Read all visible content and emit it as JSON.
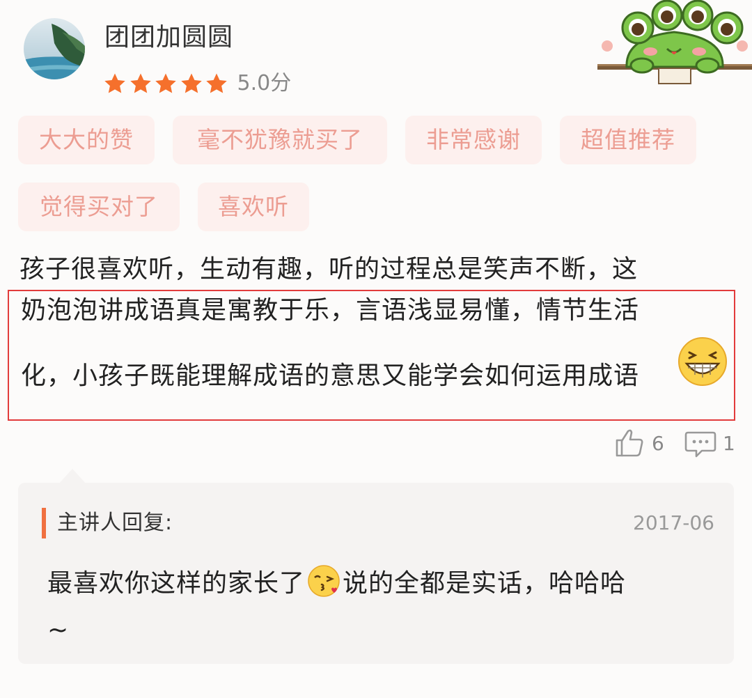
{
  "user": {
    "name": "团团加圆圆",
    "stars": 5,
    "score": "5.0分"
  },
  "tags": [
    "大大的赞",
    "毫不犹豫就买了",
    "非常感谢",
    "超值推荐",
    "觉得买对了",
    "喜欢听"
  ],
  "review": {
    "line1": "孩子很喜欢听，生动有趣，听的过程总是笑声不断，这",
    "line2": "奶泡泡讲成语真是寓教于乐，言语浅显易懂，情节生活",
    "line3": "化，小孩子既能理解成语的意思又能学会如何运用成语"
  },
  "actions": {
    "likes": "6",
    "comments": "1"
  },
  "reply": {
    "title": "主讲人回复:",
    "date": "2017-06",
    "text_before": "最喜欢你这样的家长了",
    "text_after": "说的全都是实话，哈哈哈",
    "text_line2": "~"
  },
  "colors": {
    "star": "#f5702c",
    "tag_bg": "#fdf0ee",
    "tag_text": "#ec9d92",
    "highlight": "#e23b3b",
    "reply_bar": "#f07040"
  },
  "icons": [
    "star-icon",
    "thumbs-up-icon",
    "comment-icon",
    "grinning-emoji",
    "kiss-emoji",
    "frog-sticker"
  ]
}
